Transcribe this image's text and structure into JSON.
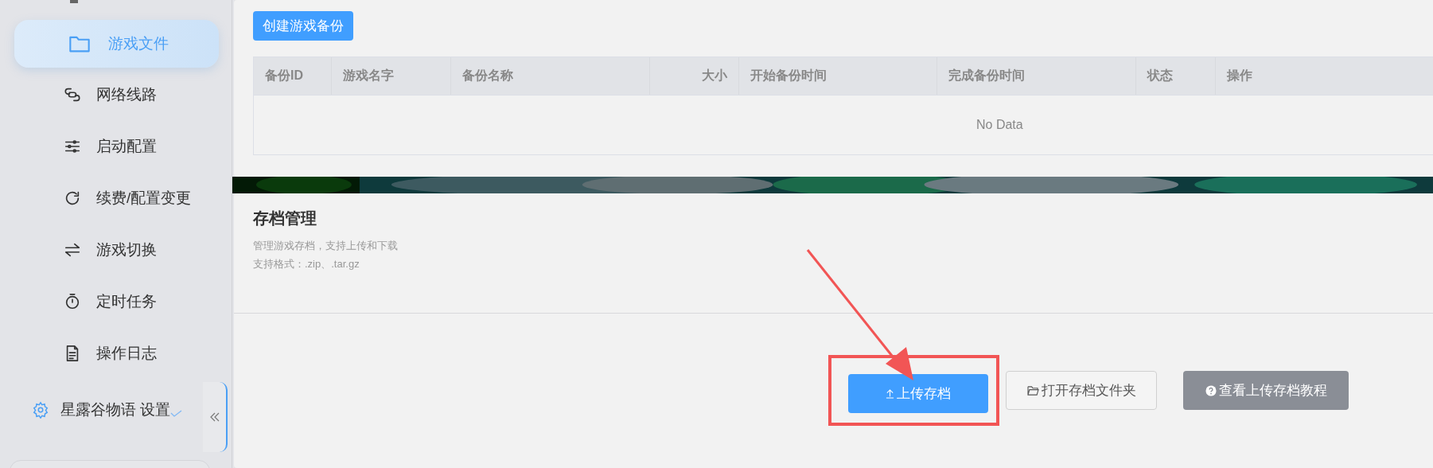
{
  "sidebar": {
    "items": [
      {
        "label": "游戏文件",
        "selected": true
      },
      {
        "label": "网络线路",
        "selected": false
      },
      {
        "label": "启动配置",
        "selected": false
      },
      {
        "label": "续费/配置变更",
        "selected": false
      },
      {
        "label": "游戏切换",
        "selected": false
      },
      {
        "label": "定时任务",
        "selected": false
      },
      {
        "label": "操作日志",
        "selected": false
      }
    ],
    "settings": {
      "label": "星露谷物语 设置"
    }
  },
  "backup": {
    "create_button": "创建游戏备份",
    "table": {
      "columns": [
        "备份ID",
        "游戏名字",
        "备份名称",
        "大小",
        "开始备份时间",
        "完成备份时间",
        "状态",
        "操作"
      ],
      "empty_text": "No Data"
    }
  },
  "saves": {
    "title": "存档管理",
    "description": [
      "管理游戏存档，支持上传和下载",
      "支持格式：.zip、.tar.gz"
    ],
    "buttons": [
      {
        "label": "上传存档",
        "kind": "primary",
        "highlighted": true
      },
      {
        "label": "打开存档文件夹",
        "kind": "default",
        "highlighted": false
      },
      {
        "label": "查看上传存档教程",
        "kind": "info",
        "highlighted": false
      }
    ]
  }
}
